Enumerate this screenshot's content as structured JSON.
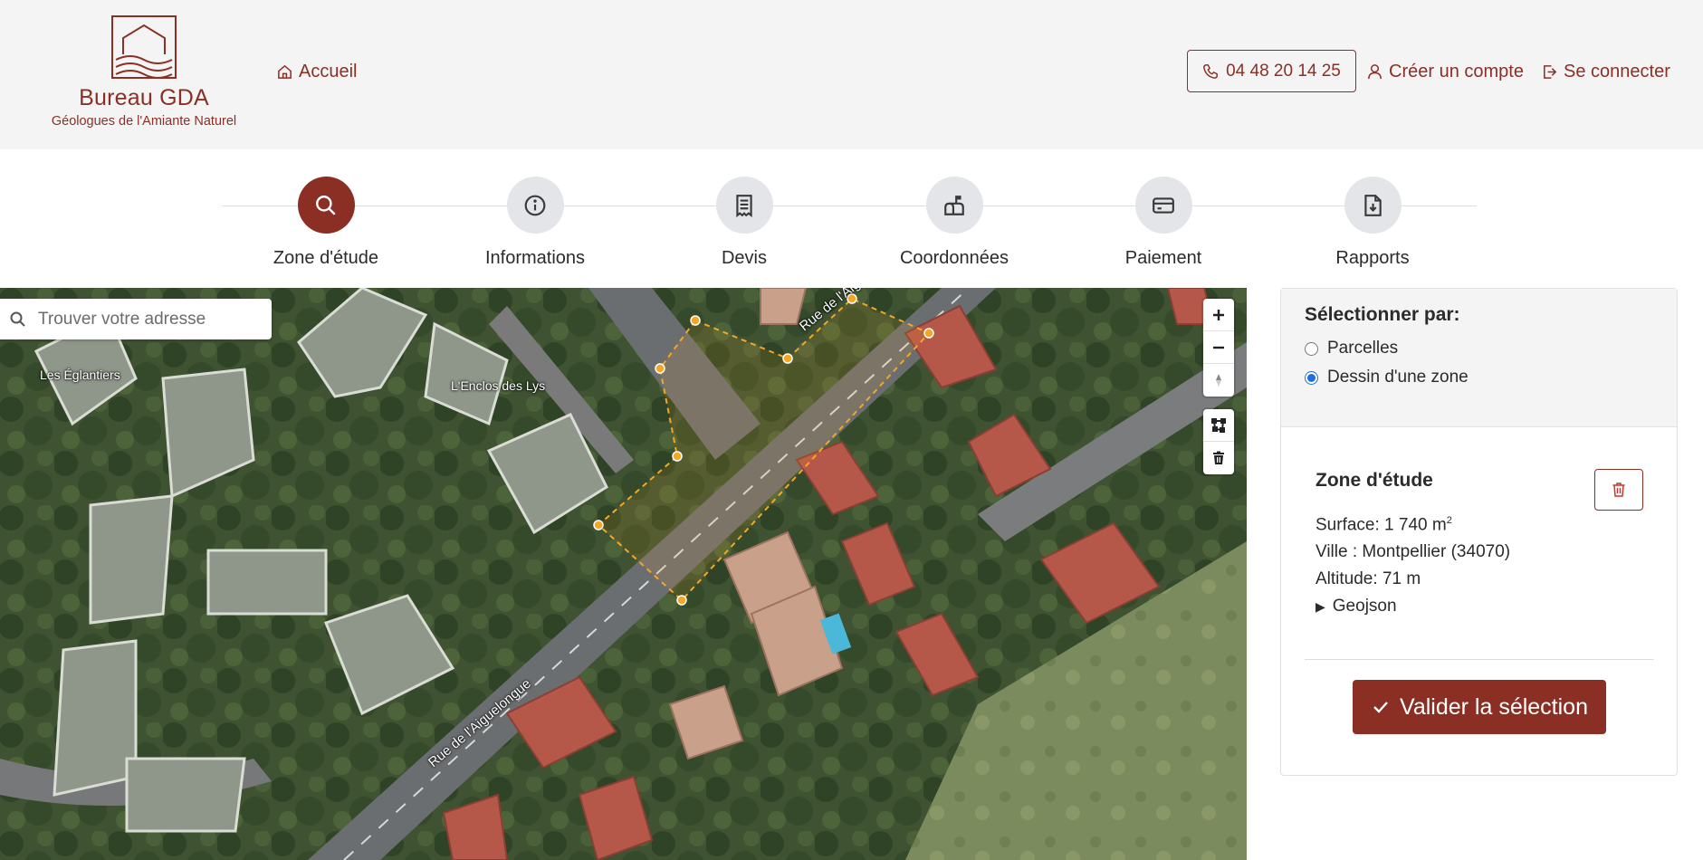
{
  "header": {
    "brand_name": "Bureau GDA",
    "brand_tagline": "Géologues de l'Amiante Naturel",
    "home_label": "Accueil",
    "phone": "04 48 20 14 25",
    "create_account": "Créer un compte",
    "login": "Se connecter"
  },
  "steps": [
    {
      "label": "Zone d'étude",
      "icon": "search-icon",
      "active": true
    },
    {
      "label": "Informations",
      "icon": "info-icon",
      "active": false
    },
    {
      "label": "Devis",
      "icon": "receipt-icon",
      "active": false
    },
    {
      "label": "Coordonnées",
      "icon": "mailbox-icon",
      "active": false
    },
    {
      "label": "Paiement",
      "icon": "credit-card-icon",
      "active": false
    },
    {
      "label": "Rapports",
      "icon": "file-download-icon",
      "active": false
    }
  ],
  "map": {
    "search_placeholder": "Trouver votre adresse",
    "labels": {
      "eglantiers": "Les Églantiers",
      "enclos": "L'Enclos des Lys",
      "street_upper": "Rue de l'Aiguelongue",
      "street_lower": "Rue de l'Aiguelongue"
    },
    "controls": [
      "zoom-in",
      "zoom-out",
      "reset-north",
      "draw-polygon",
      "delete"
    ]
  },
  "panel": {
    "select_heading": "Sélectionner par:",
    "options": [
      {
        "label": "Parcelles",
        "checked": false
      },
      {
        "label": "Dessin d'une zone",
        "checked": true
      }
    ],
    "zone_title": "Zone d'étude",
    "surface_label": "Surface: 1 740 m",
    "surface_unit_sup": "2",
    "ville": "Ville : Montpellier (34070)",
    "altitude": "Altitude: 71 m",
    "geojson_label": "Geojson",
    "validate_label": "Valider la sélection"
  },
  "colors": {
    "brand": "#8b2f24",
    "header_bg": "#f4f4f5",
    "polygon": "#f5a623"
  }
}
